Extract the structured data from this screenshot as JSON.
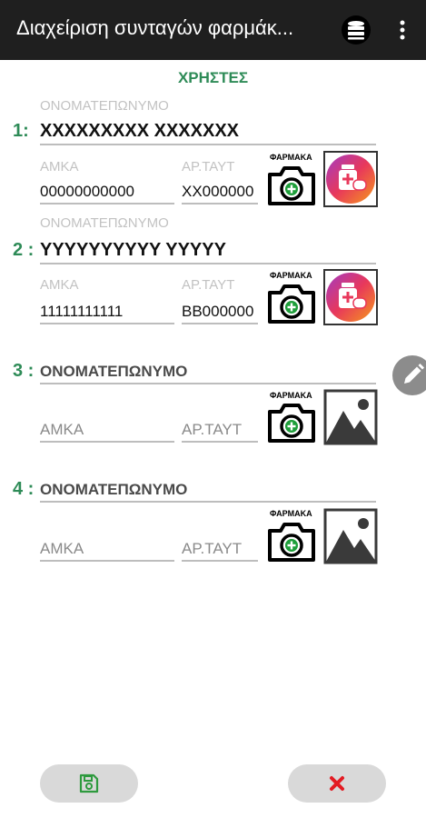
{
  "appbar": {
    "title": "Διαχείριση συνταγών φαρμάκ...",
    "db_icon": "database-icon",
    "more_icon": "more-vert-icon"
  },
  "section_title": "ΧΡΗΣΤΕΣ",
  "users": [
    {
      "number": "1:",
      "name_label": "ΟΝΟΜΑΤΕΠΩΝΥΜΟ",
      "name": "XXXXXXXXX XXXXXXX",
      "amka_label": "ΑΜΚΑ",
      "amka": "00000000000",
      "id_label": "ΑΡ.ΤΑΥΤ",
      "id": "XX000000",
      "camera_label": "ΦΑΡΜΑΚΑ",
      "thumb": "medicine-app-icon"
    },
    {
      "number": "2 :",
      "name_label": "ΟΝΟΜΑΤΕΠΩΝΥΜΟ",
      "name": "YYYYYYYYYY YYYYY",
      "amka_label": "ΑΜΚΑ",
      "amka": "11111111111",
      "id_label": "ΑΡ.ΤΑΥΤ",
      "id": "BB000000",
      "camera_label": "ΦΑΡΜΑΚΑ",
      "thumb": "medicine-app-icon"
    },
    {
      "number": "3 :",
      "name_placeholder": "ΟΝΟΜΑΤΕΠΩΝΥΜΟ",
      "amka_placeholder": "ΑΜΚΑ",
      "id_placeholder": "ΑΡ.ΤΑΥΤ",
      "camera_label": "ΦΑΡΜΑΚΑ",
      "thumb": "image-placeholder-icon"
    },
    {
      "number": "4 :",
      "name_placeholder": "ΟΝΟΜΑΤΕΠΩΝΥΜΟ",
      "amka_placeholder": "ΑΜΚΑ",
      "id_placeholder": "ΑΡ.ΤΑΥΤ",
      "camera_label": "ΦΑΡΜΑΚΑ",
      "thumb": "image-placeholder-icon"
    }
  ],
  "fab": {
    "icon": "pencil-edit-icon"
  },
  "buttons": {
    "save_icon": "save-floppy-icon",
    "cancel_icon": "close-x-icon"
  },
  "colors": {
    "appbar": "#1f1f1f",
    "accent": "#2e8b57",
    "cancel": "#e31b23",
    "save": "#2e9a3e",
    "fab": "#8c8c8c",
    "button_bg": "#d9d9d9"
  }
}
